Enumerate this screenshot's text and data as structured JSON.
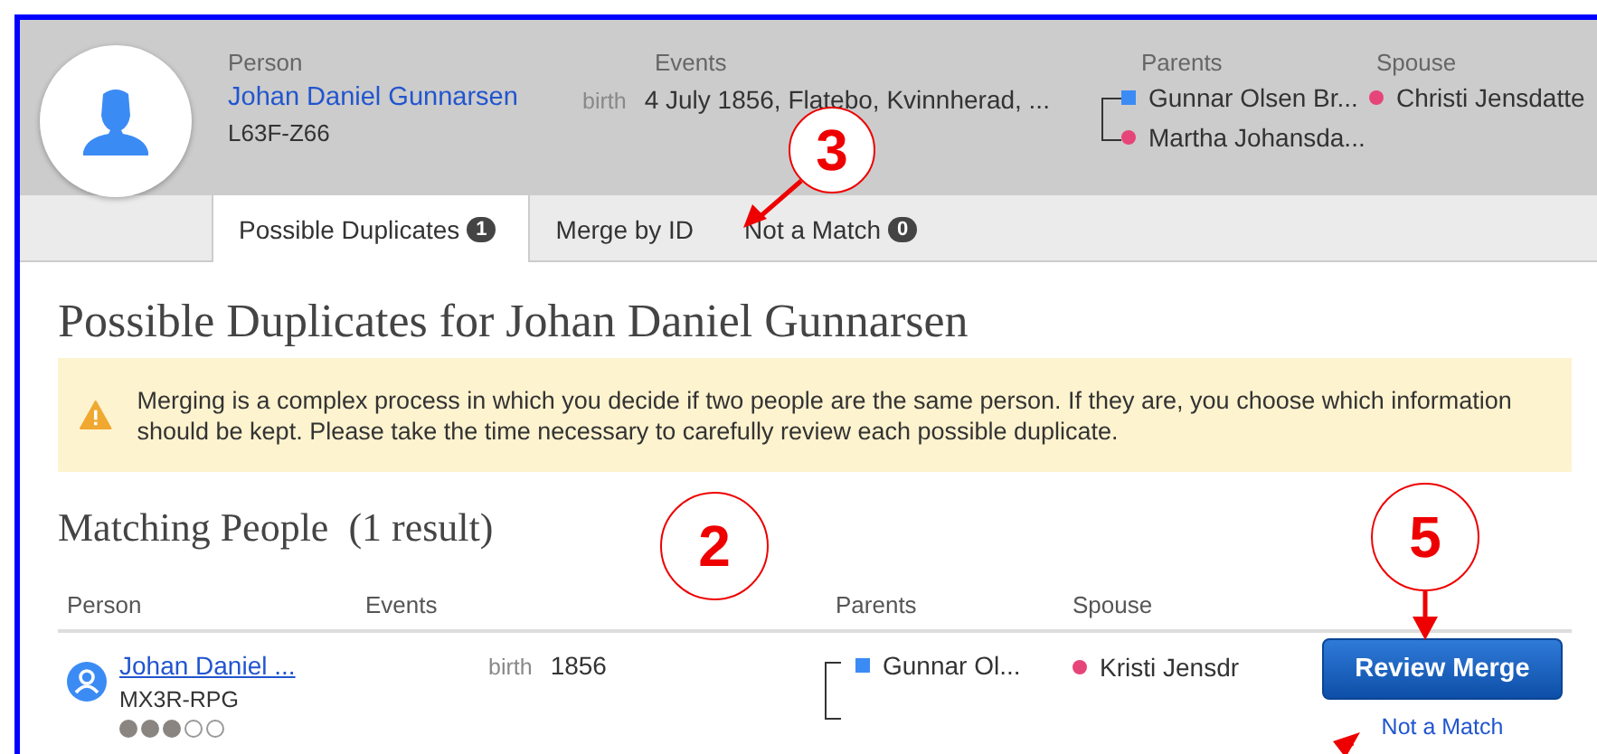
{
  "person": {
    "label": "Person",
    "name": "Johan Daniel Gunnarsen",
    "id": "L63F-Z66",
    "events_label": "Events",
    "event_type": "birth",
    "event": "4 July 1856, Flatebo, Kvinnherad, ...",
    "parents_label": "Parents",
    "parents": [
      {
        "name": "Gunnar Olsen Br...",
        "kind": "male"
      },
      {
        "name": "Martha Johansda...",
        "kind": "female"
      }
    ],
    "spouse_label": "Spouse",
    "spouse": {
      "name": "Christi Jensdatte",
      "kind": "female"
    }
  },
  "tabs": [
    {
      "label": "Possible Duplicates",
      "count": "1",
      "selected": true
    },
    {
      "label": "Merge by ID",
      "selected": false
    },
    {
      "label": "Not a Match",
      "count": "0",
      "selected": false
    }
  ],
  "title": "Possible Duplicates for Johan Daniel Gunnarsen",
  "warning": "Merging is a complex process in which you decide if two people are the same person. If they are, you choose which information should be kept. Please take the time necessary to carefully review each possible duplicate.",
  "matching": {
    "heading": "Matching People  (1 result)",
    "columns": [
      "Person",
      "Events",
      "Parents",
      "Spouse"
    ],
    "rows": [
      {
        "name": "Johan Daniel ...",
        "id": "MX3R-RPG",
        "stars": 3,
        "event_type": "birth",
        "event": "1856",
        "parent": {
          "name": "Gunnar Ol...",
          "kind": "male"
        },
        "spouse": {
          "name": "Kristi Jensdr",
          "kind": "female"
        },
        "action": "Review Merge",
        "link": "Not a Match"
      }
    ]
  },
  "callouts": [
    {
      "label": "3"
    },
    {
      "label": "2"
    },
    {
      "label": "5"
    },
    {
      "kind": "arrow"
    }
  ]
}
